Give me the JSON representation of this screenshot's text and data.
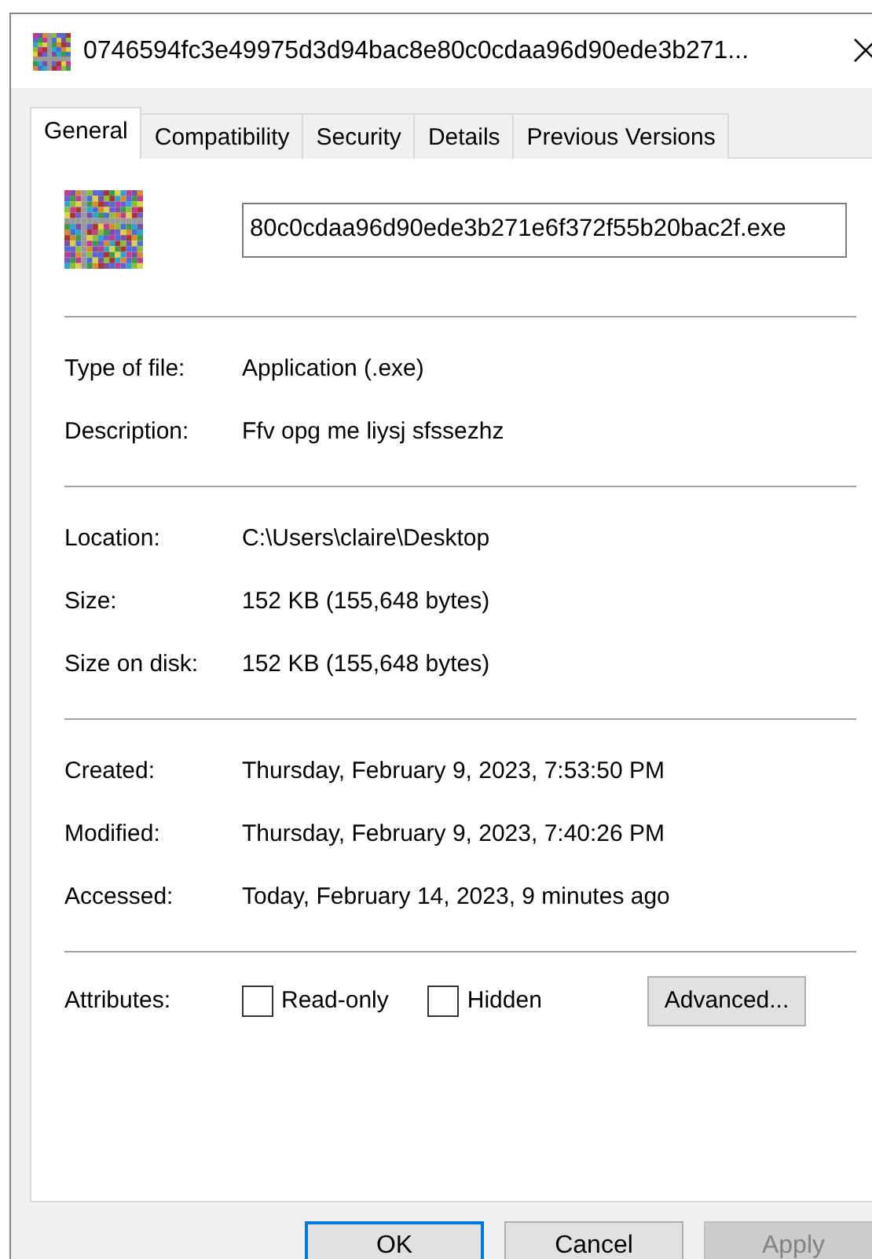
{
  "window": {
    "title": "0746594fc3e49975d3d94bac8e80c0cdaa96d90ede3b271..."
  },
  "tabs": [
    {
      "label": "General",
      "selected": true
    },
    {
      "label": "Compatibility",
      "selected": false
    },
    {
      "label": "Security",
      "selected": false
    },
    {
      "label": "Details",
      "selected": false
    },
    {
      "label": "Previous Versions",
      "selected": false
    }
  ],
  "file_name": {
    "value": "80c0cdaa96d90ede3b271e6f372f55b20bac2f.exe"
  },
  "sections": [
    [
      {
        "label": "Type of file:",
        "value": "Application (.exe)"
      },
      {
        "label": "Description:",
        "value": "Ffv opg me liysj sfssezhz"
      }
    ],
    [
      {
        "label": "Location:",
        "value": "C:\\Users\\claire\\Desktop"
      },
      {
        "label": "Size:",
        "value": "152 KB (155,648 bytes)"
      },
      {
        "label": "Size on disk:",
        "value": "152 KB (155,648 bytes)"
      }
    ],
    [
      {
        "label": "Created:",
        "value": "Thursday, February 9, 2023, 7:53:50 PM"
      },
      {
        "label": "Modified:",
        "value": "Thursday, February 9, 2023, 7:40:26 PM"
      },
      {
        "label": "Accessed:",
        "value": "Today, February 14, 2023, 9 minutes ago"
      }
    ]
  ],
  "attributes": {
    "label": "Attributes:",
    "checkboxes": [
      {
        "label": "Read-only",
        "checked": false
      },
      {
        "label": "Hidden",
        "checked": false
      }
    ],
    "advanced_button": "Advanced..."
  },
  "buttons": [
    {
      "label": "OK",
      "default": true,
      "disabled": false
    },
    {
      "label": "Cancel",
      "default": false,
      "disabled": false
    },
    {
      "label": "Apply",
      "default": false,
      "disabled": true
    }
  ]
}
